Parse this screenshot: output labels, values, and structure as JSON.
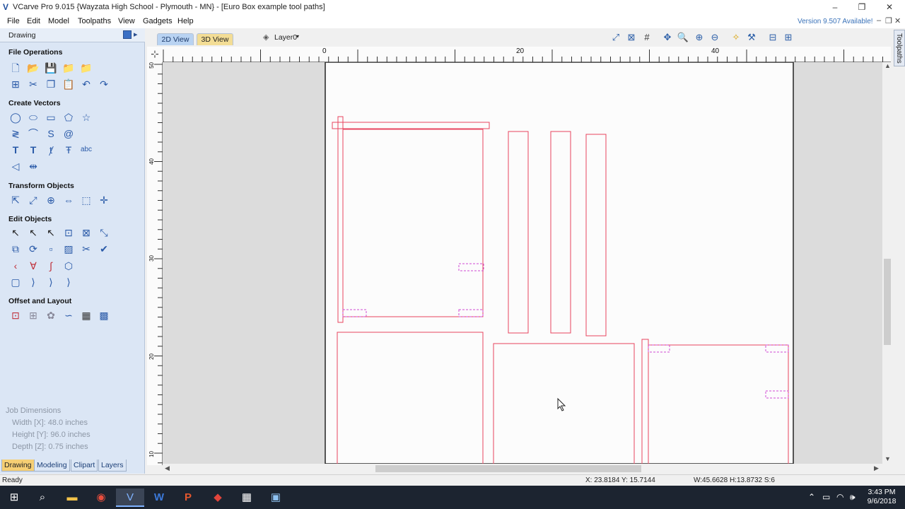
{
  "window": {
    "app_icon": "vcarve-logo-icon",
    "title": "VCarve Pro 9.015 {Wayzata High School - Plymouth - MN} - [Euro Box example tool paths]",
    "minimize": "–",
    "restore": "❐",
    "close": "✕"
  },
  "menu": {
    "items": [
      "File",
      "Edit",
      "Model",
      "Toolpaths",
      "View",
      "Gadgets",
      "Help"
    ],
    "version_notice": "Version 9.507 Available!"
  },
  "left_panel": {
    "title": "Drawing",
    "sections": {
      "file_operations": "File Operations",
      "create_vectors": "Create Vectors",
      "transform_objects": "Transform Objects",
      "edit_objects": "Edit Objects",
      "offset_layout": "Offset and Layout"
    },
    "job_dimensions": {
      "heading": "Job Dimensions",
      "width": "Width  [X]: 48.0 inches",
      "height": "Height [Y]: 96.0 inches",
      "depth": "Depth  [Z]: 0.75 inches"
    },
    "bottom_tabs": [
      "Drawing",
      "Modeling",
      "Clipart",
      "Layers"
    ]
  },
  "view_tabs": {
    "view_2d": "2D View",
    "view_3d": "3D View"
  },
  "layer_selector": {
    "label": "Layer0",
    "icon": "layer-icon"
  },
  "side_tab": "Toolpaths",
  "ruler": {
    "h_labels": [
      "0",
      "20",
      "40"
    ],
    "v_labels": [
      "50",
      "40",
      "30",
      "20",
      "10"
    ]
  },
  "status": {
    "left": "Ready",
    "coords": "X: 23.8184 Y: 15.7144",
    "size": "W:45.6628  H:13.8732  S:6"
  },
  "taskbar": {
    "time": "3:43 PM",
    "date": "9/6/2018"
  },
  "colors": {
    "vector_line": "#e8435e",
    "selected_dashed": "#d04ad4",
    "panel_bg": "#dbe6f5",
    "active_tab": "#f6cf74"
  }
}
